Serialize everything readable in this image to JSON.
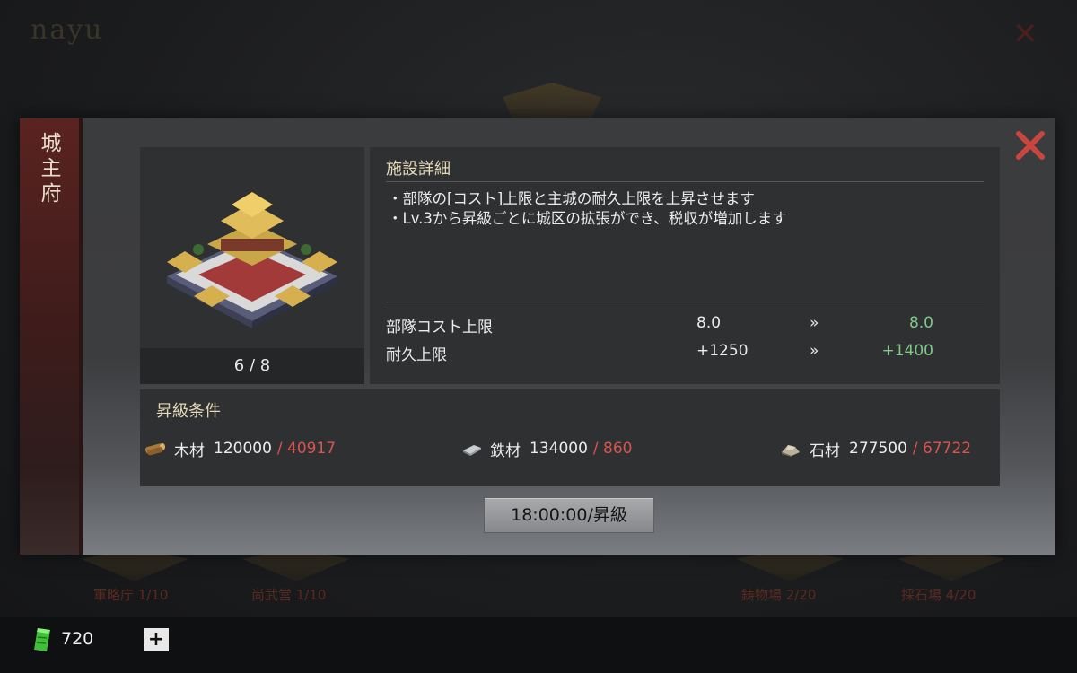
{
  "background": {
    "logo": "nayu",
    "buildings": [
      {
        "label": "軍略庁 1/10"
      },
      {
        "label": "尚武営 1/10"
      },
      {
        "label": "鋳物場 2/20"
      },
      {
        "label": "採石場 4/20"
      }
    ]
  },
  "dialog": {
    "title": "城主府",
    "level": "6 / 8",
    "detail": {
      "heading": "施設詳細",
      "lines": [
        "・部隊の[コスト]上限と主城の耐久上限を上昇させます",
        "・Lv.3から昇級ごとに城区の拡張ができ、税収が増加します"
      ],
      "stats": [
        {
          "label": "部隊コスト上限",
          "current": "8.0",
          "arrow": "»",
          "next": "8.0"
        },
        {
          "label": "耐久上限",
          "current": "+1250",
          "arrow": "»",
          "next": "+1400"
        }
      ]
    },
    "requirements": {
      "heading": "昇級条件",
      "items": [
        {
          "name": "木材",
          "need": "120000",
          "have": "/ 40917",
          "icon": "wood-icon"
        },
        {
          "name": "鉄材",
          "need": "134000",
          "have": "/ 860",
          "icon": "iron-icon"
        },
        {
          "name": "石材",
          "need": "277500",
          "have": "/ 67722",
          "icon": "stone-icon"
        }
      ]
    },
    "upgrade_button": "18:00:00/昇級"
  },
  "bottom_bar": {
    "jade_count": "720",
    "plus_label": "+"
  },
  "colors": {
    "insufficient": "#d9534f",
    "increase": "#7fc98a",
    "banner": "#5a2320"
  }
}
